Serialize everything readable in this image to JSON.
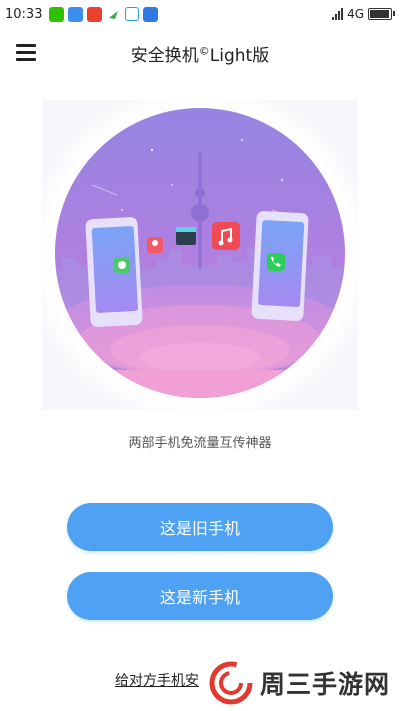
{
  "status_bar": {
    "time": "10:33",
    "network": "4G",
    "notification_icons": [
      "wechat-icon",
      "chat-icon",
      "news-icon",
      "bird-icon",
      "qr-icon",
      "shield-icon"
    ]
  },
  "header": {
    "title": "安全换机",
    "title_mark": "©",
    "title_suffix": "Light版"
  },
  "main": {
    "illustration_icons": [
      "game-app-icon",
      "contact-app-icon",
      "video-app-icon",
      "music-app-icon",
      "phone-app-icon"
    ],
    "subtitle": "两部手机免流量互传神器",
    "old_phone_button": "这是旧手机",
    "new_phone_button": "这是新手机",
    "bottom_link": "给对方手机安"
  },
  "watermark": {
    "text": "周三手游网"
  },
  "colors": {
    "primary": "#4ea1f3",
    "illustration_top": "#8f7ee0",
    "illustration_bottom": "#e983d3"
  }
}
